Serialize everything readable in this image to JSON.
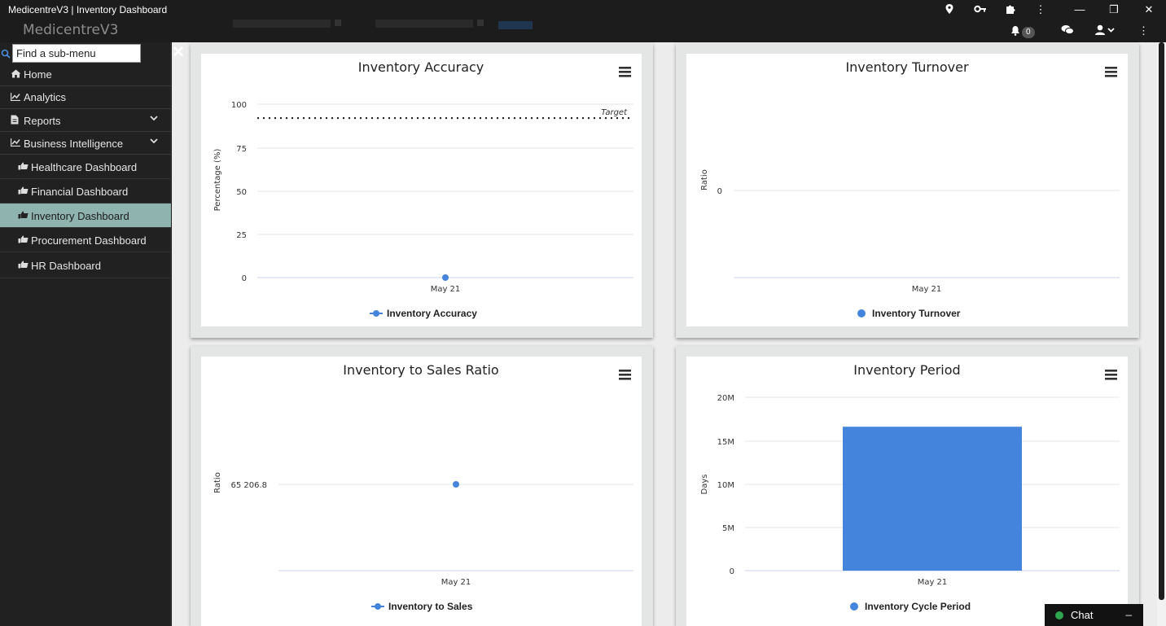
{
  "window": {
    "title": "MedicentreV3 | Inventory Dashboard"
  },
  "app": {
    "brand": "MedicentreV3",
    "notifications_count": "0"
  },
  "sidebar": {
    "search_placeholder": "Find a sub-menu",
    "items": [
      {
        "label": "Home",
        "icon": "home-icon"
      },
      {
        "label": "Analytics",
        "icon": "chart-icon"
      },
      {
        "label": "Reports",
        "icon": "document-icon",
        "expandable": true
      },
      {
        "label": "Business Intelligence",
        "icon": "chart-icon",
        "expandable": true
      }
    ],
    "subitems": [
      {
        "label": "Healthcare Dashboard",
        "active": false
      },
      {
        "label": "Financial Dashboard",
        "active": false
      },
      {
        "label": "Inventory Dashboard",
        "active": true
      },
      {
        "label": "Procurement Dashboard",
        "active": false
      },
      {
        "label": "HR Dashboard",
        "active": false
      }
    ]
  },
  "chat": {
    "label": "Chat"
  },
  "colors": {
    "series": "#4484dc",
    "grid": "#e6e6e6",
    "active_menu": "#8fb4b0"
  },
  "chart_data": [
    {
      "type": "line",
      "title": "Inventory Accuracy",
      "ylabel": "Percentage (%)",
      "categories": [
        "May 21"
      ],
      "series": [
        {
          "name": "Inventory Accuracy",
          "values": [
            0
          ]
        }
      ],
      "yticks": [
        "0",
        "25",
        "50",
        "75",
        "100"
      ],
      "ylim": [
        0,
        100
      ],
      "plot_lines": [
        {
          "label": "Target",
          "value": 92,
          "style": "dotted"
        }
      ]
    },
    {
      "type": "scatter",
      "title": "Inventory Turnover",
      "ylabel": "Ratio",
      "categories": [
        "May 21"
      ],
      "series": [
        {
          "name": "Inventory Turnover",
          "values": []
        }
      ],
      "yticks": [
        "0"
      ]
    },
    {
      "type": "line",
      "title": "Inventory to Sales Ratio",
      "ylabel": "Ratio",
      "categories": [
        "May 21"
      ],
      "series": [
        {
          "name": "Inventory to Sales",
          "values": [
            65206.8
          ]
        }
      ],
      "yticks": [
        "65 206.8"
      ]
    },
    {
      "type": "bar",
      "title": "Inventory Period",
      "ylabel": "Days",
      "categories": [
        "May 21"
      ],
      "series": [
        {
          "name": "Inventory Cycle Period",
          "values": [
            16600000
          ]
        }
      ],
      "yticks": [
        "0",
        "5M",
        "10M",
        "15M",
        "20M"
      ],
      "ylim": [
        0,
        20000000
      ]
    }
  ]
}
